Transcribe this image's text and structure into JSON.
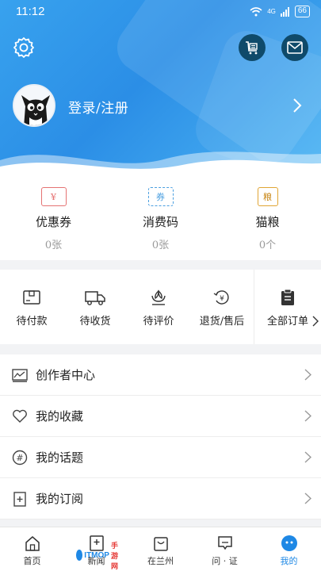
{
  "status_bar": {
    "time": "11:12",
    "network": "4G",
    "battery": "66"
  },
  "profile": {
    "login_text": "登录/注册"
  },
  "wallet": [
    {
      "icon": "coupon-icon",
      "icon_text": "¥",
      "label": "优惠券",
      "value": "0张",
      "color": "#e57373"
    },
    {
      "icon": "voucher-code-icon",
      "icon_text": "券",
      "label": "消费码",
      "value": "0张",
      "color": "#4a9fe0"
    },
    {
      "icon": "cat-food-icon",
      "icon_text": "粮",
      "label": "猫粮",
      "value": "0个",
      "color": "#e0a534"
    }
  ],
  "orders": [
    {
      "icon": "pending-payment-icon",
      "label": "待付款"
    },
    {
      "icon": "pending-delivery-icon",
      "label": "待收货"
    },
    {
      "icon": "pending-review-icon",
      "label": "待评价"
    },
    {
      "icon": "refund-icon",
      "label": "退货/售后"
    },
    {
      "icon": "all-orders-icon",
      "label": "全部订单"
    }
  ],
  "menu": [
    {
      "icon": "creator-center-icon",
      "label": "创作者中心"
    },
    {
      "icon": "favorites-icon",
      "label": "我的收藏"
    },
    {
      "icon": "topics-icon",
      "label": "我的话题"
    },
    {
      "icon": "subscriptions-icon",
      "label": "我的订阅"
    }
  ],
  "tabs": [
    {
      "icon": "home-icon",
      "label": "首页"
    },
    {
      "icon": "news-icon",
      "label": "新闻"
    },
    {
      "icon": "lanzhou-icon",
      "label": "在兰州"
    },
    {
      "icon": "ask-icon",
      "label": "问 · 证"
    },
    {
      "icon": "me-icon",
      "label": "我的",
      "active": true
    }
  ],
  "watermark": {
    "text": "ITMOP",
    "sub": "手游网"
  },
  "colors": {
    "header": "#2b8ee6",
    "accent": "#1e88e5",
    "dark_button": "#0f4a6a"
  }
}
